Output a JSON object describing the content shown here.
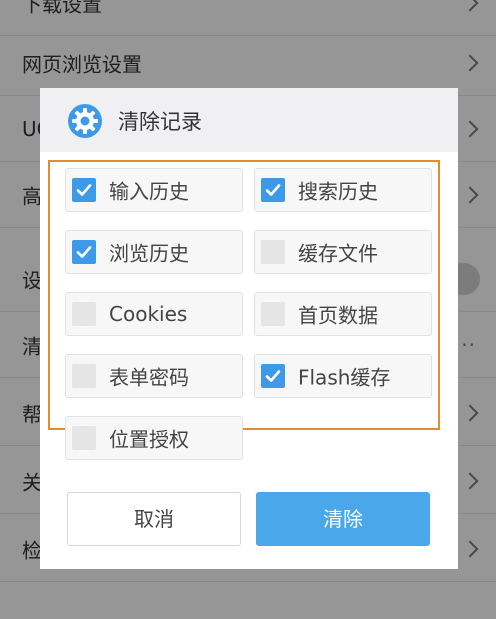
{
  "background": {
    "rows": [
      {
        "label": "下载设置",
        "control": "chevron"
      },
      {
        "label": "网页浏览设置",
        "control": "chevron"
      },
      {
        "label": "UC",
        "control": "chevron"
      },
      {
        "label": "高",
        "control": "chevron"
      },
      {
        "label": "设",
        "control": "toggle"
      },
      {
        "label": "清",
        "control": "dots"
      },
      {
        "label": "帮",
        "control": "chevron"
      },
      {
        "label": "关",
        "control": "chevron"
      },
      {
        "label": "检",
        "control": "chevron"
      }
    ]
  },
  "dialog": {
    "title": "清除记录",
    "icon": "gear-icon",
    "accent_color": "#3d9ae8",
    "highlight_frame_color": "#e68a2e",
    "options": [
      {
        "label": "输入历史",
        "checked": true
      },
      {
        "label": "搜索历史",
        "checked": true
      },
      {
        "label": "浏览历史",
        "checked": true
      },
      {
        "label": "缓存文件",
        "checked": false
      },
      {
        "label": "Cookies",
        "checked": false
      },
      {
        "label": "首页数据",
        "checked": false
      },
      {
        "label": "表单密码",
        "checked": false
      },
      {
        "label": "Flash缓存",
        "checked": true
      },
      {
        "label": "位置授权",
        "checked": false
      }
    ],
    "cancel_label": "取消",
    "clear_label": "清除"
  }
}
